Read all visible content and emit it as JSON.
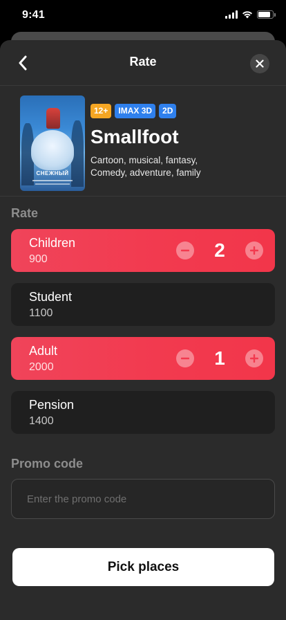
{
  "status_bar": {
    "time": "9:41",
    "battery_level": 0.85
  },
  "header": {
    "title": "Rate",
    "back_icon": "chevron-left-icon",
    "close_icon": "close-icon"
  },
  "movie": {
    "poster_icon": "movie-poster",
    "poster_title": "СНЕЖНЫЙ",
    "badges": [
      "12+",
      "IMAX 3D",
      "2D"
    ],
    "title": "Smallfoot",
    "genres": "Cartoon, musical, fantasy, Comedy, adventure, family"
  },
  "rate_section": {
    "label": "Rate",
    "rows": [
      {
        "name": "Children",
        "price": "900",
        "quantity": "2",
        "active": true
      },
      {
        "name": "Student",
        "price": "1100",
        "active": false
      },
      {
        "name": "Adult",
        "price": "2000",
        "quantity": "1",
        "active": true
      },
      {
        "name": "Pension",
        "price": "1400",
        "active": false
      }
    ]
  },
  "promo": {
    "label": "Promo code",
    "placeholder": "Enter the promo code",
    "value": ""
  },
  "actions": {
    "pick_places": "Pick places"
  },
  "colors": {
    "accent": "#f23a4f",
    "sheet": "#2b2b2b",
    "row": "#1f1f1f",
    "age_badge": "#f5a623",
    "format_badge": "#2f80ed"
  }
}
